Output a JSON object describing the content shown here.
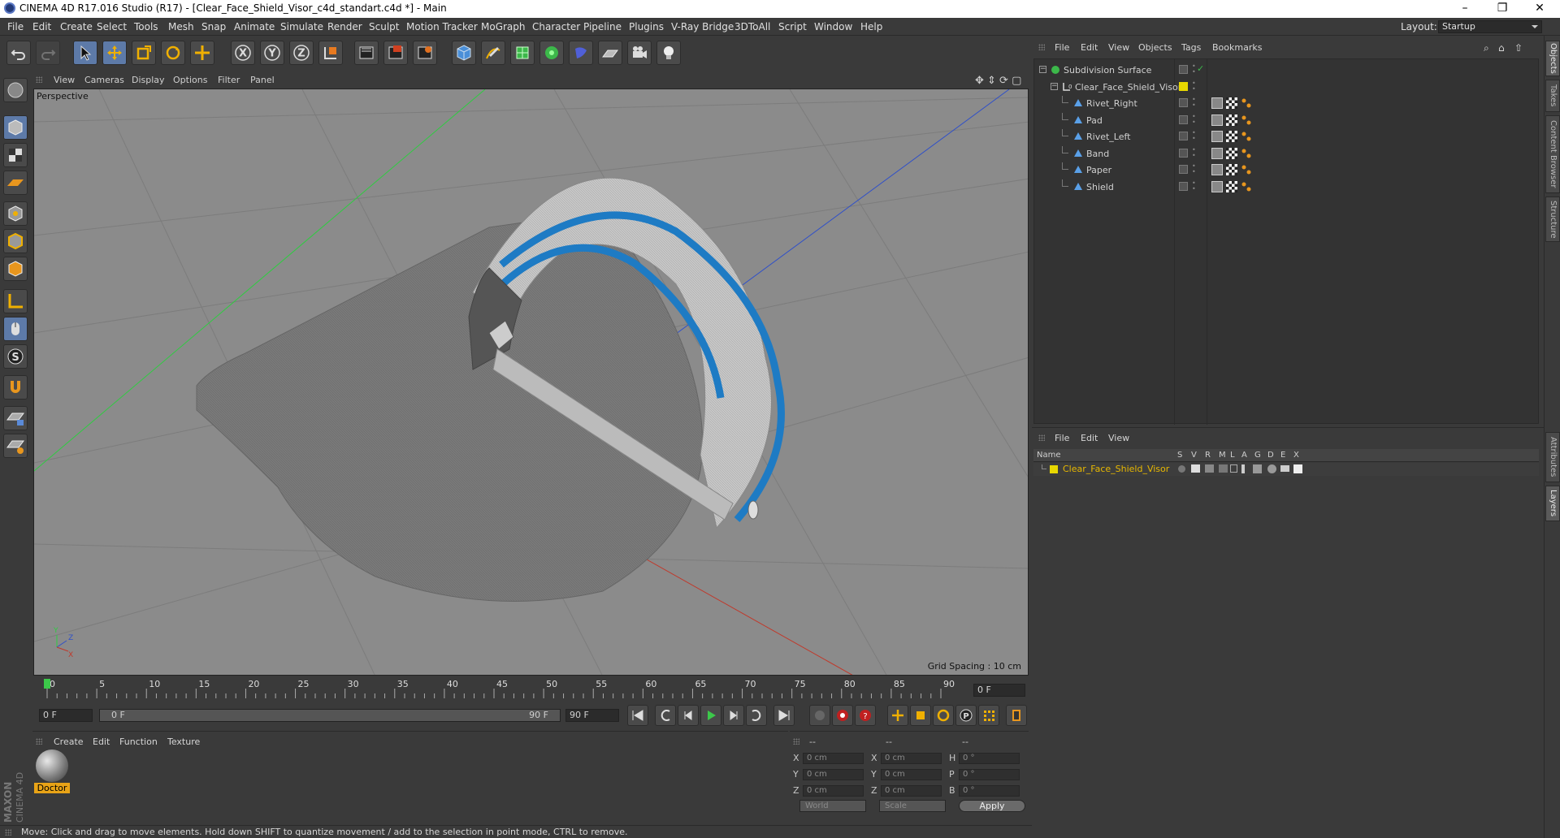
{
  "window": {
    "title": "CINEMA 4D R17.016 Studio (R17) - [Clear_Face_Shield_Visor_c4d_standart.c4d *] - Main",
    "minimize": "–",
    "maximize": "❐",
    "close": "✕"
  },
  "menubar": {
    "items": [
      "File",
      "Edit",
      "Create",
      "Select",
      "Tools",
      "Mesh",
      "Snap",
      "Animate",
      "Simulate",
      "Render",
      "Sculpt",
      "Motion Tracker",
      "MoGraph",
      "Character",
      "Pipeline",
      "Plugins",
      "V-Ray Bridge",
      "3DToAll",
      "Script",
      "Window",
      "Help"
    ],
    "layout_label": "Layout:",
    "layout_value": "Startup"
  },
  "toolbar": {
    "icons": [
      "undo-icon",
      "redo-icon",
      "select-icon",
      "move-icon",
      "scale-icon",
      "rotate-icon",
      "move-alt-icon",
      "x-axis-icon",
      "y-axis-icon",
      "z-axis-icon",
      "world-coord-icon",
      "render-view-icon",
      "render-region-icon",
      "render-picture-icon",
      "cube-icon",
      "pen-icon",
      "subdivision-icon",
      "cloner-icon",
      "deformer-icon",
      "floor-icon",
      "camera-icon",
      "light-icon"
    ],
    "x_label": "X",
    "y_label": "Y",
    "z_label": "Z"
  },
  "viewport": {
    "menu": [
      "View",
      "Cameras",
      "Display",
      "Options",
      "Filter",
      "Panel"
    ],
    "label": "Perspective",
    "grid_spacing": "Grid Spacing : 10 cm",
    "axis_labels": {
      "y": "Y",
      "z": "Z",
      "x": "X"
    },
    "colors": {
      "background": "#8b8b8b",
      "visor_band": "#1e7bc4",
      "x_axis": "#c0392b",
      "y_axis": "#2ecc40",
      "z_axis": "#3050c8"
    }
  },
  "timeline": {
    "ticks": [
      "0",
      "5",
      "10",
      "15",
      "20",
      "25",
      "30",
      "35",
      "40",
      "45",
      "50",
      "55",
      "60",
      "65",
      "70",
      "75",
      "80",
      "85",
      "90"
    ],
    "current_frame": "0 F",
    "start_field": "0 F",
    "range_start": "0 F",
    "range_end": "90 F",
    "end_field": "90 F"
  },
  "material_manager": {
    "menu": [
      "Create",
      "Edit",
      "Function",
      "Texture"
    ],
    "materials": [
      {
        "name": "Doctor"
      }
    ]
  },
  "coordinates": {
    "headers": [
      "--",
      "--",
      "--"
    ],
    "rows": [
      {
        "a_label": "X",
        "a_val": "0 cm",
        "b_label": "X",
        "b_val": "0 cm",
        "c_label": "H",
        "c_val": "0 °"
      },
      {
        "a_label": "Y",
        "a_val": "0 cm",
        "b_label": "Y",
        "b_val": "0 cm",
        "c_label": "P",
        "c_val": "0 °"
      },
      {
        "a_label": "Z",
        "a_val": "0 cm",
        "b_label": "Z",
        "b_val": "0 cm",
        "c_label": "B",
        "c_val": "0 °"
      }
    ],
    "mode_world": "World",
    "mode_scale": "Scale",
    "apply": "Apply"
  },
  "object_manager": {
    "menu": [
      "File",
      "Edit",
      "View",
      "Objects",
      "Tags",
      "Bookmarks"
    ],
    "objects": [
      {
        "name": "Subdivision Surface",
        "indent": 0,
        "icon": "subdivision-icon"
      },
      {
        "name": "Clear_Face_Shield_Visor",
        "indent": 1,
        "icon": "null-icon"
      },
      {
        "name": "Rivet_Right",
        "indent": 2,
        "icon": "polygon-icon"
      },
      {
        "name": "Pad",
        "indent": 2,
        "icon": "polygon-icon"
      },
      {
        "name": "Rivet_Left",
        "indent": 2,
        "icon": "polygon-icon"
      },
      {
        "name": "Band",
        "indent": 2,
        "icon": "polygon-icon"
      },
      {
        "name": "Paper",
        "indent": 2,
        "icon": "polygon-icon"
      },
      {
        "name": "Shield",
        "indent": 2,
        "icon": "polygon-icon"
      }
    ]
  },
  "layer_manager": {
    "menu": [
      "File",
      "Edit",
      "View"
    ],
    "columns": [
      "Name",
      "S",
      "V",
      "R",
      "M",
      "L",
      "A",
      "G",
      "D",
      "E",
      "X"
    ],
    "layers": [
      {
        "name": "Clear_Face_Shield_Visor",
        "color": "#e8d800"
      }
    ]
  },
  "right_tabs": [
    "Objects",
    "Takes",
    "Content Browser",
    "Structure",
    "Attributes",
    "Layers"
  ],
  "status": "Move: Click and drag to move elements. Hold down SHIFT to quantize movement / add to the selection in point mode, CTRL to remove."
}
